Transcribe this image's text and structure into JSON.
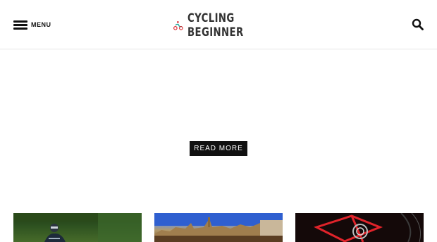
{
  "header": {
    "menu_label": "MENU",
    "logo": {
      "line1": "CYCLING",
      "line2": "BEGINNER"
    },
    "icons": {
      "menu": "hamburger-icon",
      "search": "search-icon",
      "logo": "cyclist-logo-icon"
    }
  },
  "main": {
    "read_more_label": "READ MORE"
  },
  "cards": [
    {
      "image": "cyclist-riding-photo"
    },
    {
      "image": "city-skyline-photo"
    },
    {
      "image": "red-bike-frame-photo"
    }
  ],
  "colors": {
    "accent_red": "#d8232a",
    "accent_teal": "#1aa79a",
    "button_bg": "#111111",
    "text": "#333333"
  }
}
